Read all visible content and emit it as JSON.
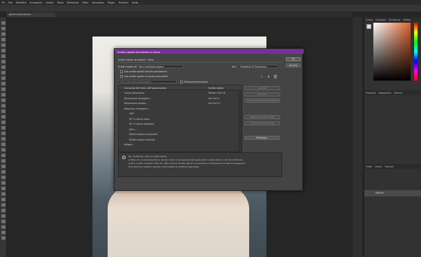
{
  "menubar": {
    "items": [
      "Ps",
      "File",
      "Modifica",
      "Immagine",
      "Livello",
      "Testo",
      "Selezione",
      "Filtro",
      "Visualizza",
      "Plugin",
      "Finestra",
      "Aiuto"
    ]
  },
  "document_tab": {
    "label": "gente malinconica..."
  },
  "right_panel": {
    "tabs": [
      "Colore",
      "Campioni",
      "Sfumature",
      "Pattern"
    ],
    "props_tabs": [
      "Proprietà",
      "Regolazioni",
      "Librerie"
    ],
    "layers_tabs": [
      "Livelli",
      "Canali",
      "Tracciati"
    ],
    "layer_name": "Sfondo"
  },
  "dialog": {
    "title": "Scelte rapide da tastiera e menu",
    "tab1": "Scelte rapide da tastiera",
    "tab2": "Menu",
    "set_label": "Set:",
    "set_value": "Predefiniti di Photoshop",
    "shortcuts_for_label": "Scelte rapide per:",
    "shortcuts_for_value": "Menu dell'applicazione",
    "check1": "Usa scelta rapida Annulla precedente",
    "check2": "Usa scelte rapide di canale precedenti",
    "search_placeholder": "Cerca nei menu Applicazioni",
    "check3": "Maiuscole/minuscole",
    "col_command": "Comando del menu dell'applicazione",
    "col_shortcut": "Scelta rapida",
    "rows": [
      {
        "cmd": "Colore automatico",
        "key": "Maiusc+Ctrl+B",
        "indent": false
      },
      {
        "cmd": "Dimensione immagine...",
        "key": "Alt+Ctrl+I",
        "indent": false
      },
      {
        "cmd": "Dimensione quadro...",
        "key": "Alt+Ctrl+C",
        "indent": false
      },
      {
        "cmd": "Rotazione immagine >",
        "key": "",
        "indent": false
      },
      {
        "cmd": "180°",
        "key": "",
        "indent": true
      },
      {
        "cmd": "90° in senso orario",
        "key": "",
        "indent": true
      },
      {
        "cmd": "90° in senso antiorario",
        "key": "",
        "indent": true
      },
      {
        "cmd": "Altro...",
        "key": "",
        "indent": true
      },
      {
        "cmd": "Rifletti quadro orizzontale",
        "key": "",
        "indent": true
      },
      {
        "cmd": "Rifletti quadro verticale",
        "key": "",
        "indent": true
      },
      {
        "cmd": "Ritaglia",
        "key": "",
        "indent": false
      }
    ],
    "buttons": {
      "ok": "OK",
      "cancel": "Annulla",
      "accept": "Accetta",
      "undo": "Annulla",
      "use_default": "Usa impostazione predefinita",
      "add_shortcut": "Aggiungi scelta rapida",
      "delete_shortcut": "Elimina scelta rapida",
      "summary": "Riepilogo..."
    },
    "info_lines": [
      "Per modificare i tasti di scelta rapida:",
      "1) Fate clic sul pulsante Nuovo set per creare una copia del set selezionato o selezionate un set da modificare.",
      "2) Per un dato comando, fate clic nella colonna \"Scelta rapida\" e premete la combinazione di tasti da assegnare.",
      "3) Al termine, salvate il set per memorizzare le modifiche apportate."
    ]
  }
}
